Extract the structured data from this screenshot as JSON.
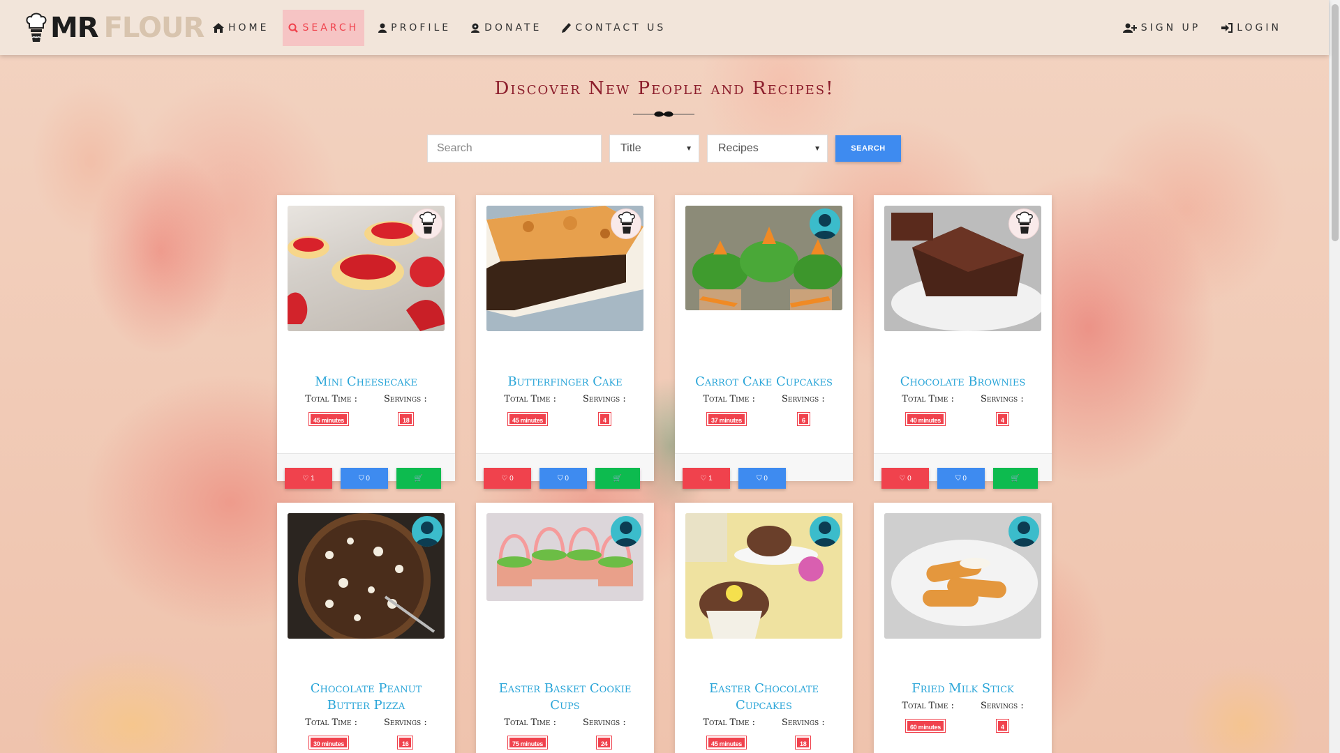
{
  "brand": {
    "mr": "MR",
    "flour": "FLOUR"
  },
  "nav": {
    "home": "HOME",
    "search": "SEARCH",
    "profile": "PROFILE",
    "donate": "DONATE",
    "contact": "CONTACT US",
    "signup": "SIGN UP",
    "login": "LOGIN"
  },
  "page_title": "Discover New People and Recipes!",
  "search": {
    "placeholder": "Search",
    "filter_selected": "Title",
    "type_selected": "Recipes",
    "button": "SEARCH"
  },
  "labels": {
    "total_time": "Total Time :",
    "servings": "Servings :"
  },
  "recipes": [
    {
      "title": "Mini Cheesecake",
      "time": "45 minutes",
      "servings": "18",
      "likes": "1",
      "saves": "0",
      "cart": true,
      "avatar": "chef"
    },
    {
      "title": "Butterfinger Cake",
      "time": "45 minutes",
      "servings": "4",
      "likes": "0",
      "saves": "0",
      "cart": true,
      "avatar": "chef"
    },
    {
      "title": "Carrot Cake Cupcakes",
      "time": "37 minutes",
      "servings": "6",
      "likes": "1",
      "saves": "0",
      "cart": false,
      "avatar": "user"
    },
    {
      "title": "Chocolate Brownies",
      "time": "40 minutes",
      "servings": "4",
      "likes": "0",
      "saves": "0",
      "cart": true,
      "avatar": "chef"
    },
    {
      "title": "Chocolate Peanut Butter Pizza",
      "time": "30 minutes",
      "servings": "16",
      "avatar": "user"
    },
    {
      "title": "Easter Basket Cookie Cups",
      "time": "75 minutes",
      "servings": "24",
      "avatar": "user"
    },
    {
      "title": "Easter Chocolate Cupcakes",
      "time": "45 minutes",
      "servings": "18",
      "avatar": "user"
    },
    {
      "title": "Fried Milk Stick",
      "time": "60 minutes",
      "servings": "4",
      "avatar": "user"
    }
  ],
  "colors": {
    "accent_red": "#f0424d",
    "accent_blue": "#3e8bf0",
    "accent_green": "#0dbb4f",
    "title_blue": "#2aa5d8"
  },
  "icons": [
    "home-icon",
    "search-icon",
    "user-icon",
    "donate-icon",
    "phone-icon",
    "user-plus-icon",
    "sign-in-icon",
    "heart-icon",
    "bookmark-icon",
    "cart-icon",
    "chef-hat-icon",
    "user-avatar-icon",
    "mustache-icon"
  ]
}
